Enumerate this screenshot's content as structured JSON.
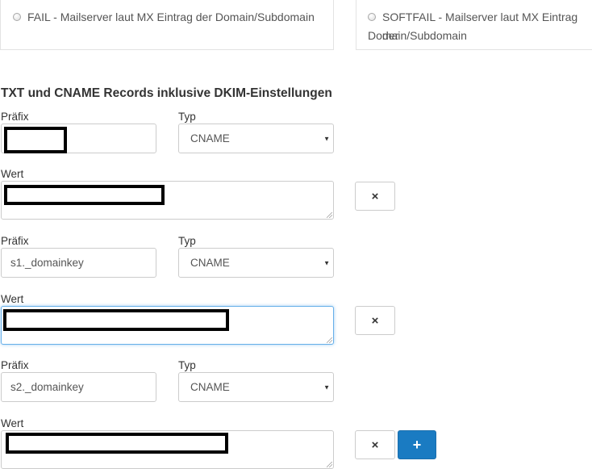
{
  "spf_options": {
    "fail_label": "FAIL - Mailserver laut MX Eintrag der Domain/Subdomain",
    "softfail_line1": "SOFTFAIL - Mailserver laut MX Eintrag der",
    "softfail_line2": "Domain/Subdomain"
  },
  "section_title": "TXT und CNAME Records inklusive DKIM-Einstellungen",
  "records": [
    {
      "prefix_label": "Präfix",
      "prefix_value": "",
      "type_label": "Typ",
      "type_value": "CNAME",
      "value_label": "Wert",
      "value": ""
    },
    {
      "prefix_label": "Präfix",
      "prefix_value": "s1._domainkey",
      "type_label": "Typ",
      "type_value": "CNAME",
      "value_label": "Wert",
      "value": ""
    },
    {
      "prefix_label": "Präfix",
      "prefix_value": "s2._domainkey",
      "type_label": "Typ",
      "type_value": "CNAME",
      "value_label": "Wert",
      "value": ""
    }
  ],
  "buttons": {
    "remove_icon": "×",
    "add_icon": "+"
  },
  "icons": {
    "remove": "close-icon",
    "add": "plus-icon",
    "select_caret": "caret-down-icon"
  },
  "colors": {
    "primary": "#1a7bc2",
    "focus": "#66afe9"
  }
}
